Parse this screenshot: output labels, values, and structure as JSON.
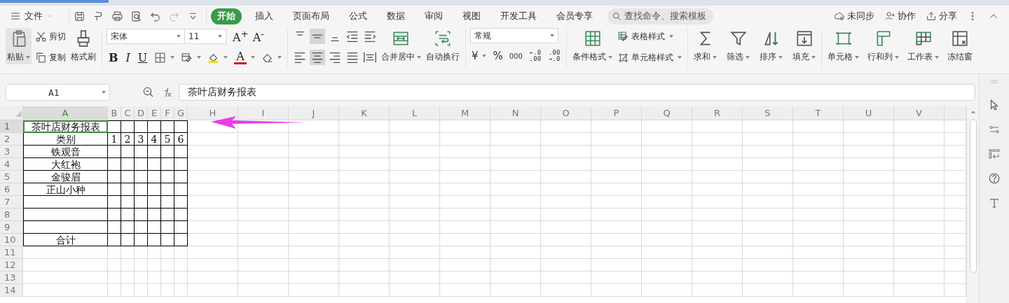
{
  "menubar": {
    "file_menu": "文件",
    "tabs": [
      {
        "label": "开始",
        "selected": true
      },
      {
        "label": "插入",
        "selected": false
      },
      {
        "label": "页面布局",
        "selected": false
      },
      {
        "label": "公式",
        "selected": false
      },
      {
        "label": "数据",
        "selected": false
      },
      {
        "label": "审阅",
        "selected": false
      },
      {
        "label": "视图",
        "selected": false
      },
      {
        "label": "开发工具",
        "selected": false
      },
      {
        "label": "会员专享",
        "selected": false
      }
    ],
    "search": {
      "placeholder": "查找命令、搜索模板"
    },
    "actions": [
      "未同步",
      "协作",
      "分享"
    ]
  },
  "ribbon": {
    "clipboard": {
      "paste": "粘贴",
      "cut": "剪切",
      "copy": "复制",
      "format_painter": "格式刷"
    },
    "font": {
      "name": "宋体",
      "size": "11",
      "grow": "A$^{+}$",
      "shrink": "A$^{-}$",
      "styles": [
        "B",
        "I",
        "U"
      ],
      "font_color": "A"
    },
    "alignment": {
      "merge": "合并居中",
      "wrap": "自动换行"
    },
    "number": {
      "format": "常规",
      "currency": "¥",
      "percent": "%",
      "thousands": "000",
      "decimals": [
        {
          "top": "←.0",
          "bottom": ".00"
        },
        {
          "top": ".00",
          "bottom": "→.0"
        }
      ]
    },
    "styles": {
      "conditional": "条件格式",
      "table_style": "表格样式",
      "cell_style": "单元格样式"
    },
    "editing": [
      "求和",
      "筛选",
      "排序",
      "填充"
    ],
    "cells": [
      "单元格",
      "行和列",
      "工作表",
      "冻结窗"
    ]
  },
  "formula_bar": {
    "name_box": "A1",
    "formula": "茶叶店财务报表"
  },
  "sheet": {
    "columns": [
      {
        "label": "A",
        "kind": "wide",
        "selected": true
      },
      {
        "label": "B",
        "kind": "narrow",
        "selected": false
      },
      {
        "label": "C",
        "kind": "narrow",
        "selected": false
      },
      {
        "label": "D",
        "kind": "narrow",
        "selected": false
      },
      {
        "label": "E",
        "kind": "narrow",
        "selected": false
      },
      {
        "label": "F",
        "kind": "narrow",
        "selected": false
      },
      {
        "label": "G",
        "kind": "narrow",
        "selected": false
      },
      {
        "label": "H",
        "kind": "normal",
        "selected": false
      },
      {
        "label": "I",
        "kind": "normal",
        "selected": false
      },
      {
        "label": "J",
        "kind": "normal",
        "selected": false
      },
      {
        "label": "K",
        "kind": "normal",
        "selected": false
      },
      {
        "label": "L",
        "kind": "normal",
        "selected": false
      },
      {
        "label": "M",
        "kind": "normal",
        "selected": false
      },
      {
        "label": "N",
        "kind": "normal",
        "selected": false
      },
      {
        "label": "O",
        "kind": "normal",
        "selected": false
      },
      {
        "label": "P",
        "kind": "normal",
        "selected": false
      },
      {
        "label": "Q",
        "kind": "normal",
        "selected": false
      },
      {
        "label": "R",
        "kind": "normal",
        "selected": false
      },
      {
        "label": "S",
        "kind": "normal",
        "selected": false
      },
      {
        "label": "T",
        "kind": "normal",
        "selected": false
      },
      {
        "label": "U",
        "kind": "normal",
        "selected": false
      },
      {
        "label": "V",
        "kind": "normal",
        "selected": false
      }
    ],
    "rows": [
      {
        "label": "1",
        "bordered": true,
        "selected": true,
        "cells": [
          "茶叶店财务报表"
        ]
      },
      {
        "label": "2",
        "bordered": true,
        "selected": false,
        "cells": [
          "类别",
          "1",
          "2",
          "3",
          "4",
          "5",
          "6"
        ]
      },
      {
        "label": "3",
        "bordered": true,
        "selected": false,
        "cells": [
          "铁观音"
        ]
      },
      {
        "label": "4",
        "bordered": true,
        "selected": false,
        "cells": [
          "大红袍"
        ]
      },
      {
        "label": "5",
        "bordered": true,
        "selected": false,
        "cells": [
          "金骏眉"
        ]
      },
      {
        "label": "6",
        "bordered": true,
        "selected": false,
        "cells": [
          "正山小种"
        ]
      },
      {
        "label": "7",
        "bordered": true,
        "selected": false,
        "cells": []
      },
      {
        "label": "8",
        "bordered": true,
        "selected": false,
        "cells": []
      },
      {
        "label": "9",
        "bordered": true,
        "selected": false,
        "cells": []
      },
      {
        "label": "10",
        "bordered": true,
        "selected": false,
        "cells": [
          "合计"
        ]
      },
      {
        "label": "11",
        "bordered": false,
        "selected": false,
        "cells": []
      },
      {
        "label": "12",
        "bordered": false,
        "selected": false,
        "cells": []
      },
      {
        "label": "13",
        "bordered": false,
        "selected": false,
        "cells": []
      },
      {
        "label": "14",
        "bordered": false,
        "selected": false,
        "cells": []
      }
    ]
  },
  "annotation": {
    "kind": "arrow"
  }
}
